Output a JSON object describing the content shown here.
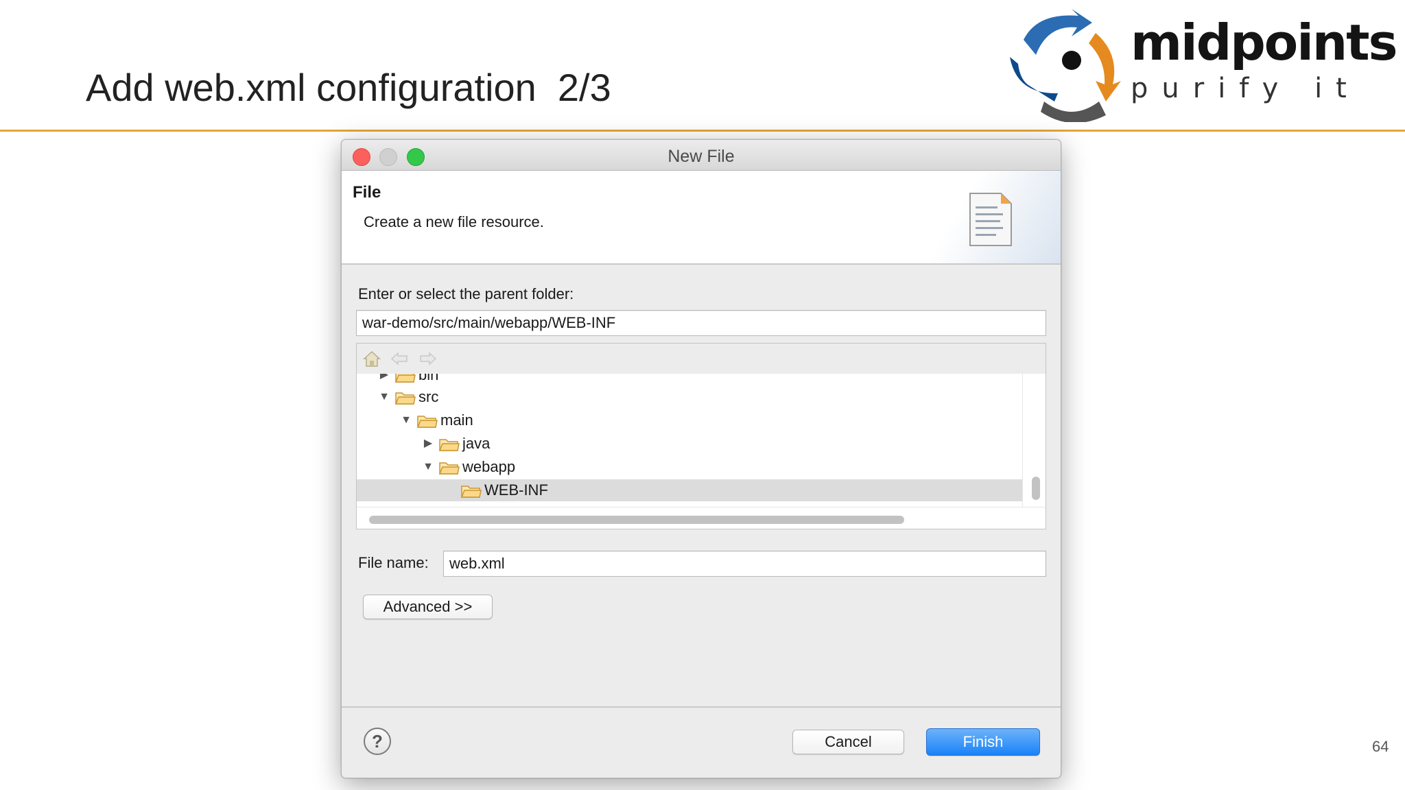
{
  "slide": {
    "title": "Add web.xml configuration  2/3",
    "page_number": "64",
    "logo": {
      "name": "midpoints",
      "tagline": "purify it"
    },
    "accent_color": "#e8a435"
  },
  "dialog": {
    "window_title": "New File",
    "banner": {
      "title": "File",
      "description": "Create a new file resource.",
      "icon": "document-icon"
    },
    "parent_folder": {
      "label": "Enter or select the parent folder:",
      "value": "war-demo/src/main/webapp/WEB-INF"
    },
    "tree": {
      "toolbar_icons": [
        "home-icon",
        "back-arrow-icon",
        "forward-arrow-icon"
      ],
      "nodes": [
        {
          "label": "bin",
          "expanded": false,
          "level": 1
        },
        {
          "label": "src",
          "expanded": true,
          "level": 1
        },
        {
          "label": "main",
          "expanded": true,
          "level": 2
        },
        {
          "label": "java",
          "expanded": false,
          "level": 3
        },
        {
          "label": "webapp",
          "expanded": true,
          "level": 3
        },
        {
          "label": "WEB-INF",
          "expanded": null,
          "level": 4,
          "selected": true
        }
      ]
    },
    "file_name": {
      "label": "File name:",
      "value": "web.xml"
    },
    "advanced_button": "Advanced >>",
    "cancel_button": "Cancel",
    "finish_button": "Finish",
    "help_symbol": "?",
    "colors": {
      "close": "#fc605c",
      "maximize": "#34c84a",
      "finish": "#1a82f7"
    }
  }
}
